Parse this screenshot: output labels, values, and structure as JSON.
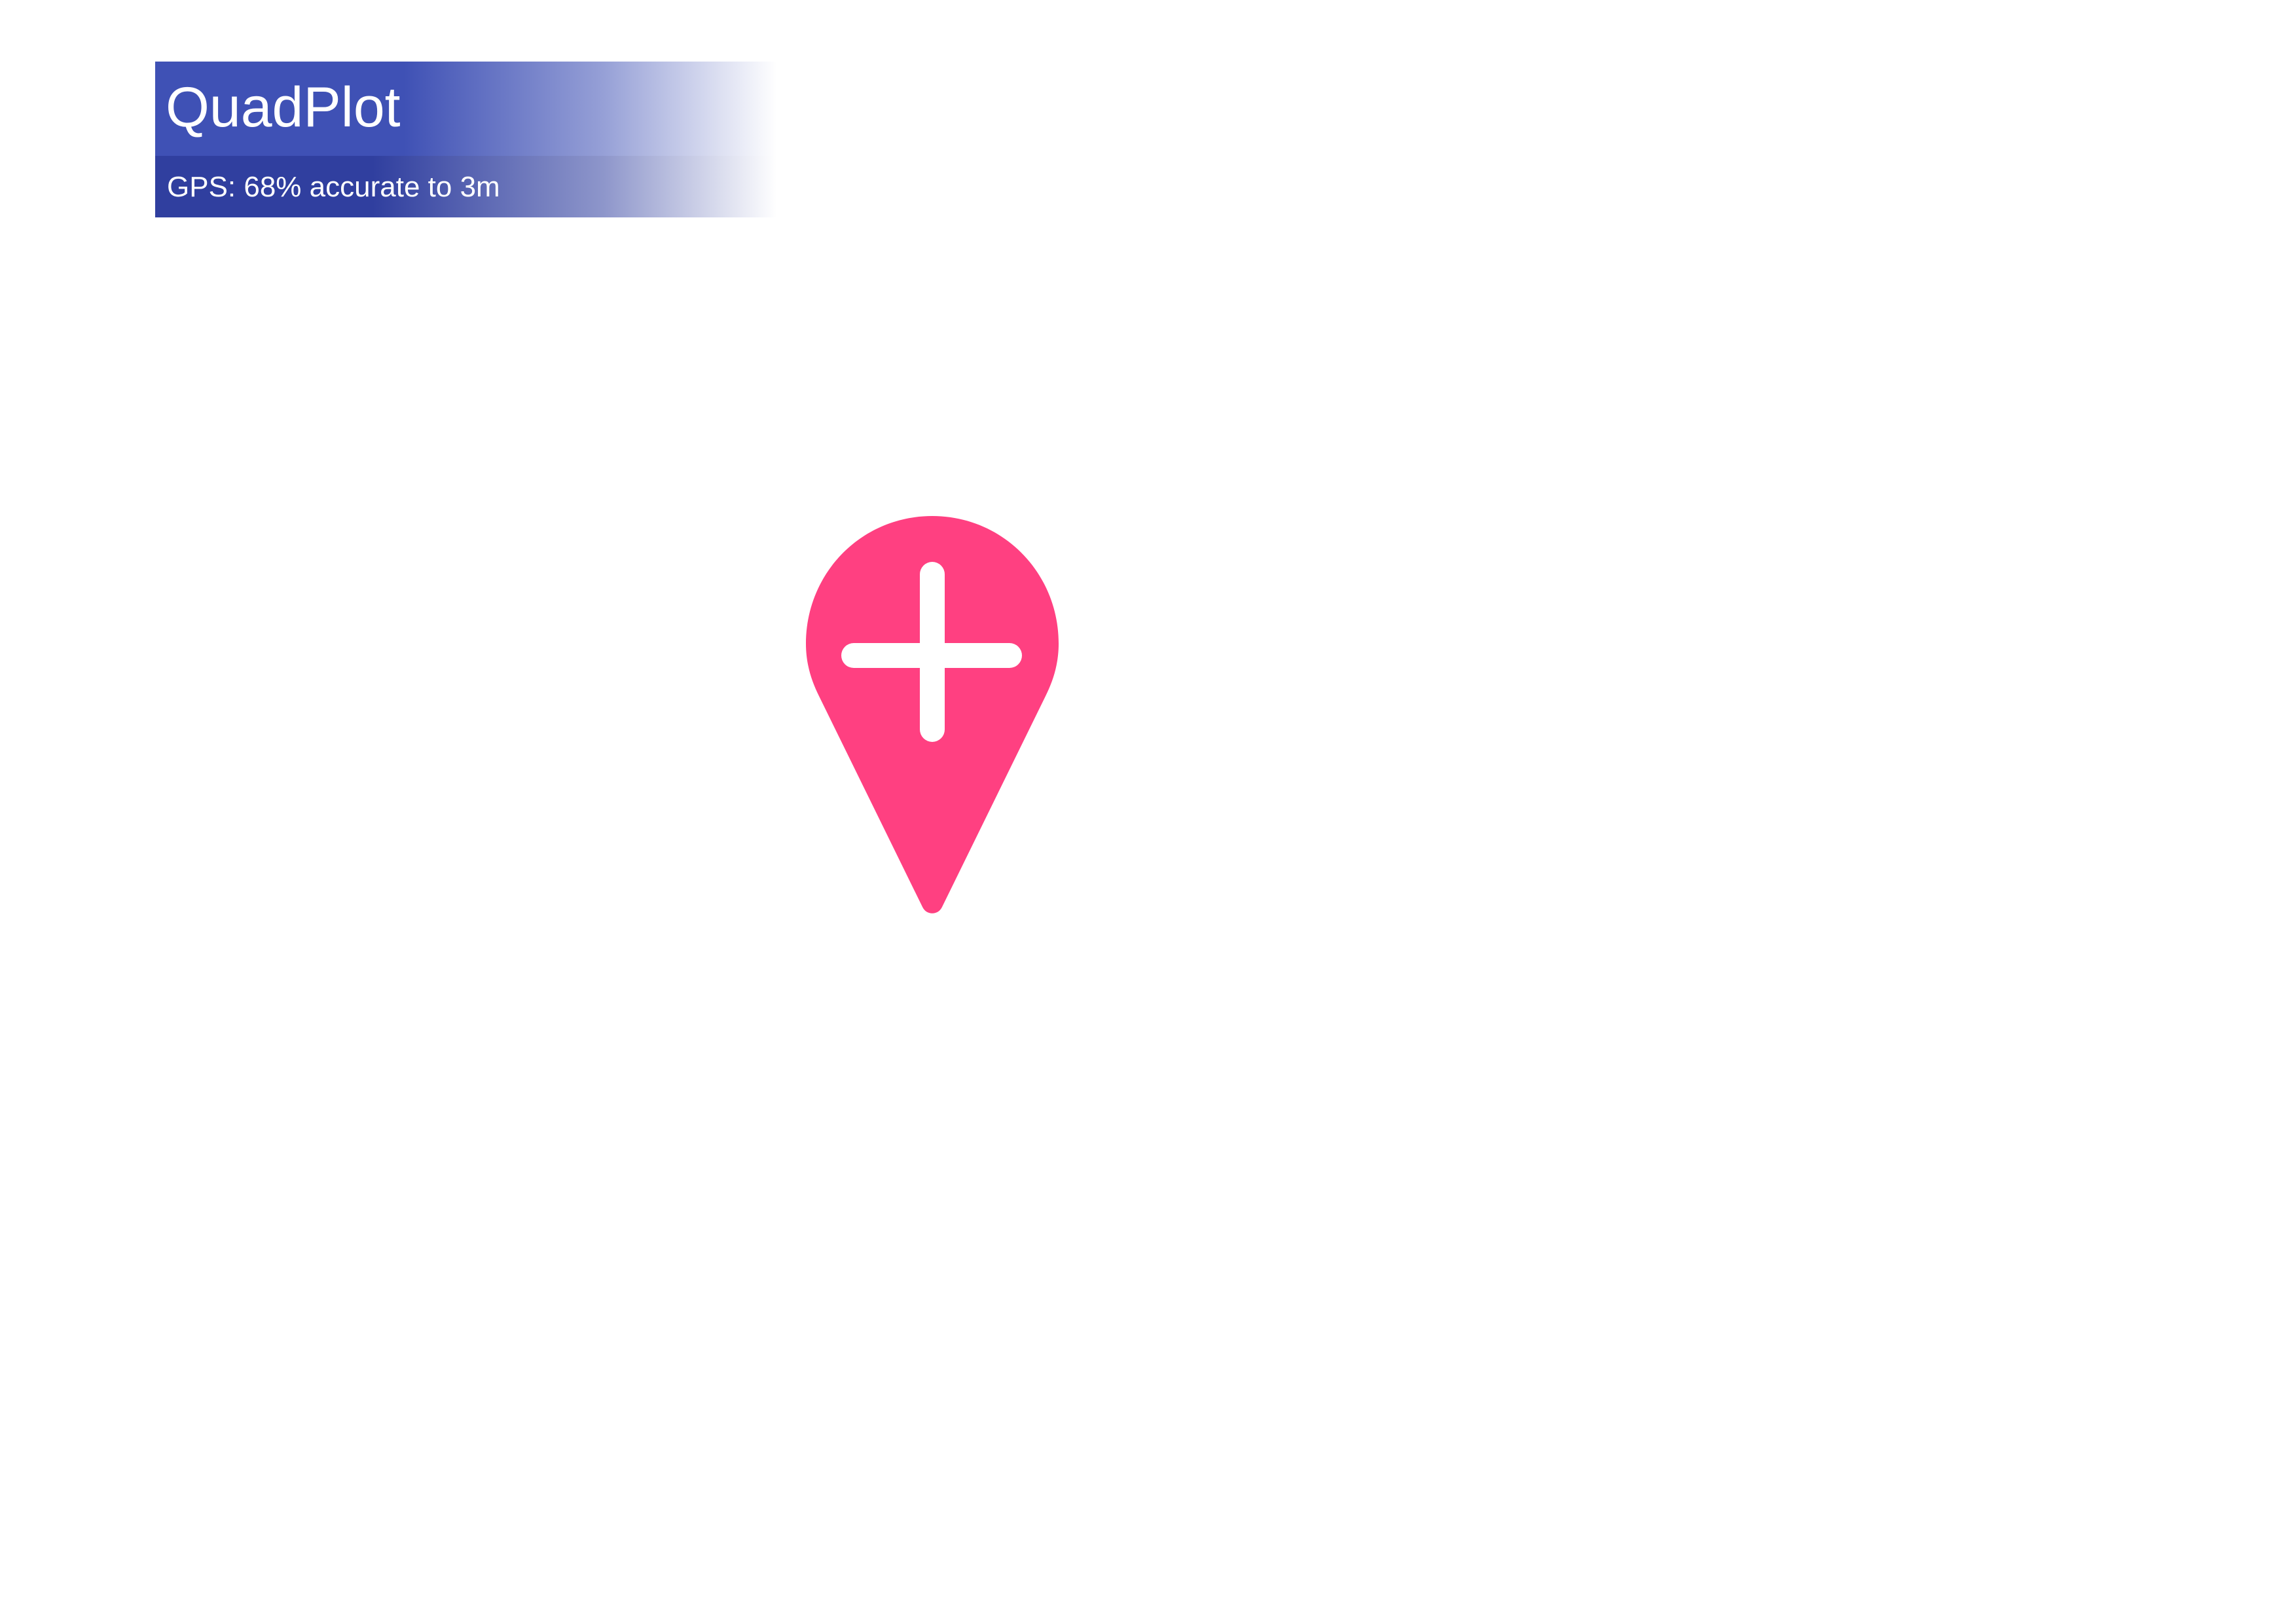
{
  "app": {
    "title": "QuadPlot"
  },
  "status": {
    "gps_text": "GPS: 68% accurate to 3m"
  },
  "add_point_button": {
    "icon": "map-pin-plus-icon",
    "color": "#ff4081"
  },
  "colors": {
    "primary": "#3f51b5",
    "primary_dark": "#303f9f",
    "accent": "#ff4081",
    "background": "#ffffff"
  }
}
